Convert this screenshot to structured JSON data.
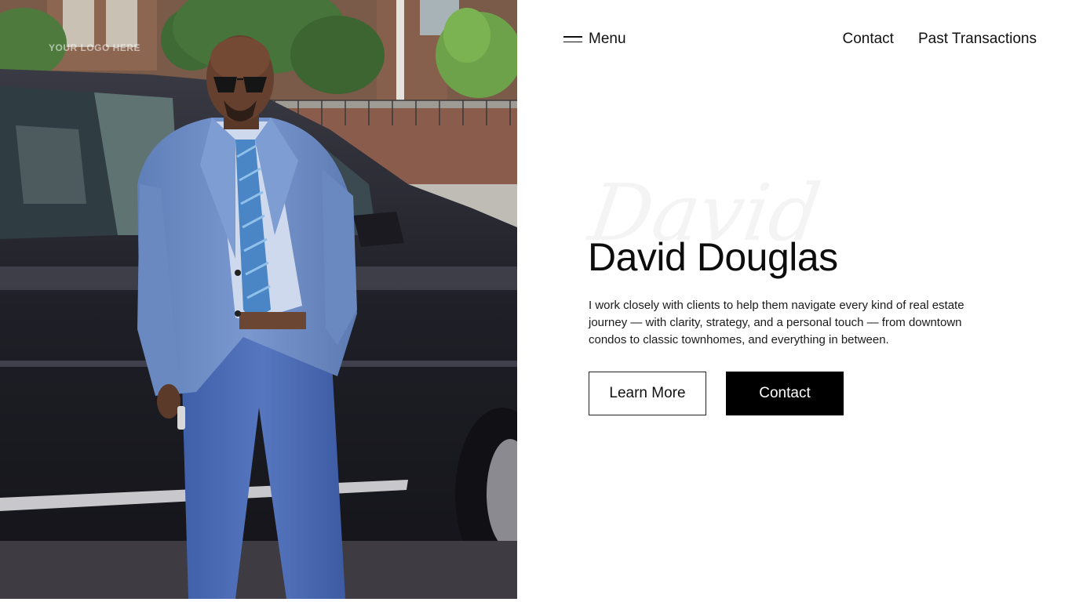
{
  "photo": {
    "alt": "Man in blue suit standing beside a black SUV",
    "logo_text": "YOUR LOGO HERE"
  },
  "nav": {
    "menu_label": "Menu",
    "links": [
      {
        "label": "Contact"
      },
      {
        "label": "Past Transactions"
      }
    ]
  },
  "hero": {
    "script_name": "David",
    "title": "David Douglas",
    "description": "I work closely with clients to help them navigate every kind of real estate journey — with clarity, strategy, and a personal touch — from downtown condos to classic townhomes, and everything in between.",
    "primary_button": "Learn More",
    "secondary_button": "Contact"
  },
  "colors": {
    "background": "#ffffff",
    "text": "#111111",
    "button_solid": "#000000",
    "suit_blue": "#6f8fc6"
  }
}
